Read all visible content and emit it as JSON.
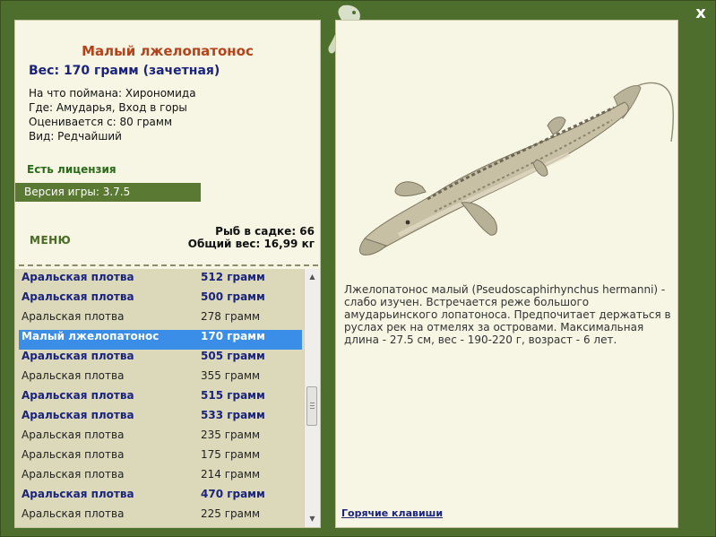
{
  "window": {
    "close_label": "x"
  },
  "fish": {
    "title": "Малый лжелопатонос",
    "weight": "Вес: 170 грамм (зачетная)",
    "caught_with": "На что поймана: Хирономида",
    "location": "Где: Амударья, Вход в горы",
    "valued_from": "Оценивается с: 80 грамм",
    "kind": "Вид: Редчайший",
    "description": "Лжелопатонос малый (Pseudoscaphirhynchus hermanni) - слабо изучен. Встречается реже большого амударьинского лопатоноса. Предпочитает держаться в руслах рек на отмелях за островами. Максимальная длина - 27.5 см, вес - 190-220 г, возраст - 6 лет.",
    "image_icon": "sturgeon-fish-image"
  },
  "license": "Есть лицензия",
  "version": "Версия игры: 3.7.5",
  "menu_label": "МЕНЮ",
  "stats": {
    "fish_in_keepnet": "Рыб в садке: 66",
    "total_weight": "Общий вес: 16,99 кг"
  },
  "catch_list": [
    {
      "name": "Аральская плотва",
      "weight": "512 грамм",
      "style": "bold"
    },
    {
      "name": "Аральская плотва",
      "weight": "500 грамм",
      "style": "bold"
    },
    {
      "name": "Аральская плотва",
      "weight": "278 грамм",
      "style": "normal"
    },
    {
      "name": "Малый лжелопатонос",
      "weight": "170 грамм",
      "style": "selected"
    },
    {
      "name": "Аральская плотва",
      "weight": "505 грамм",
      "style": "bold"
    },
    {
      "name": "Аральская плотва",
      "weight": "355 грамм",
      "style": "normal"
    },
    {
      "name": "Аральская плотва",
      "weight": "515 грамм",
      "style": "bold"
    },
    {
      "name": "Аральская плотва",
      "weight": "533 грамм",
      "style": "bold"
    },
    {
      "name": "Аральская плотва",
      "weight": "235 грамм",
      "style": "normal"
    },
    {
      "name": "Аральская плотва",
      "weight": "175 грамм",
      "style": "normal"
    },
    {
      "name": "Аральская плотва",
      "weight": "214 грамм",
      "style": "normal"
    },
    {
      "name": "Аральская плотва",
      "weight": "470 грамм",
      "style": "bold"
    },
    {
      "name": "Аральская плотва",
      "weight": "225 грамм",
      "style": "normal"
    }
  ],
  "hotkeys_link": "Горячие клавиши",
  "colors": {
    "frame_green": "#4d6e2c",
    "panel_bg": "#f7f5e3",
    "title_red": "#b2431a",
    "bold_blue": "#1a237e",
    "selected_blue": "#3b8ee8",
    "license_green": "#2a6b1a"
  }
}
